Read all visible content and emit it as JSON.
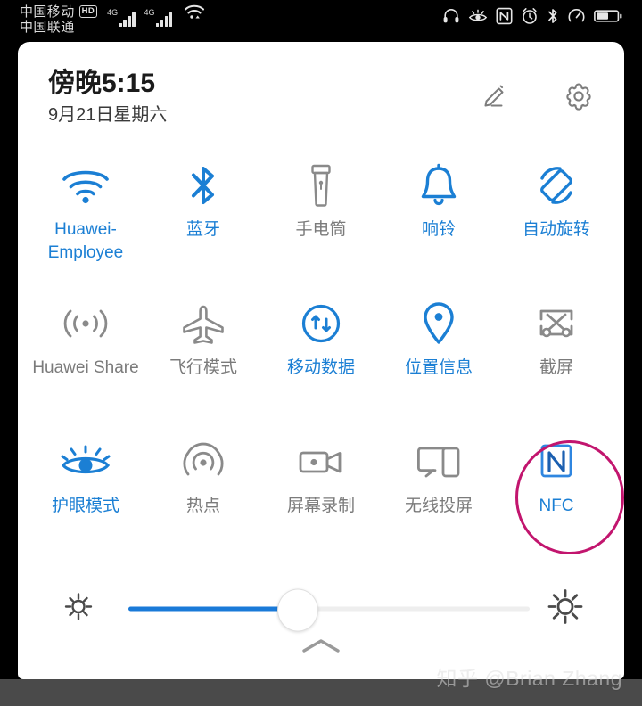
{
  "status_bar": {
    "carrier_primary": "中国移动",
    "carrier_primary_badge": "HD",
    "carrier_secondary": "中国联通",
    "network_label_1": "4G",
    "network_label_2": "4G",
    "icons": [
      {
        "name": "headphones-icon"
      },
      {
        "name": "eye-comfort-icon"
      },
      {
        "name": "nfc-icon"
      },
      {
        "name": "alarm-icon"
      },
      {
        "name": "bluetooth-icon"
      },
      {
        "name": "data-saver-icon"
      },
      {
        "name": "battery-icon"
      }
    ],
    "battery_level_percent": 55
  },
  "panel": {
    "header": {
      "time": "傍晚5:15",
      "date": "9月21日星期六",
      "edit_label": "编辑",
      "settings_label": "设置"
    },
    "toggles": [
      [
        {
          "id": "wifi",
          "label": "Huawei-Employee",
          "icon": "wifi-icon",
          "active": true
        },
        {
          "id": "bluetooth",
          "label": "蓝牙",
          "icon": "bluetooth-icon",
          "active": true
        },
        {
          "id": "flashlight",
          "label": "手电筒",
          "icon": "flashlight-icon",
          "active": false
        },
        {
          "id": "ring",
          "label": "响铃",
          "icon": "bell-icon",
          "active": true
        },
        {
          "id": "auto-rotate",
          "label": "自动旋转",
          "icon": "auto-rotate-icon",
          "active": true
        }
      ],
      [
        {
          "id": "huawei-share",
          "label": "Huawei Share",
          "icon": "huawei-share-icon",
          "active": false
        },
        {
          "id": "airplane-mode",
          "label": "飞行模式",
          "icon": "airplane-icon",
          "active": false
        },
        {
          "id": "mobile-data",
          "label": "移动数据",
          "icon": "mobile-data-icon",
          "active": true
        },
        {
          "id": "location",
          "label": "位置信息",
          "icon": "location-pin-icon",
          "active": true
        },
        {
          "id": "screenshot",
          "label": "截屏",
          "icon": "screenshot-icon",
          "active": false
        }
      ],
      [
        {
          "id": "eye-comfort",
          "label": "护眼模式",
          "icon": "eye-comfort-icon",
          "active": true
        },
        {
          "id": "hotspot",
          "label": "热点",
          "icon": "hotspot-icon",
          "active": false
        },
        {
          "id": "screen-recorder",
          "label": "屏幕录制",
          "icon": "video-camera-icon",
          "active": false
        },
        {
          "id": "wireless-projection",
          "label": "无线投屏",
          "icon": "cast-icon",
          "active": false
        },
        {
          "id": "nfc",
          "label": "NFC",
          "icon": "nfc-icon",
          "active": true
        }
      ]
    ],
    "brightness": {
      "value_percent": 42,
      "low_icon": "brightness-low-icon",
      "high_icon": "brightness-high-icon"
    },
    "collapse_icon": "chevron-up-icon"
  },
  "annotation": {
    "target": "NFC",
    "shape": "ellipse",
    "color": "#c2156e"
  },
  "watermark": {
    "text": "知乎 @Brian Zhang"
  },
  "colors": {
    "active_blue": "#1b7fd4",
    "inactive_gray": "#7b7b7b",
    "panel_bg": "#ffffff",
    "screen_bg": "#000000",
    "bottom_bar": "#4a4a4a",
    "annotation": "#c2156e"
  }
}
